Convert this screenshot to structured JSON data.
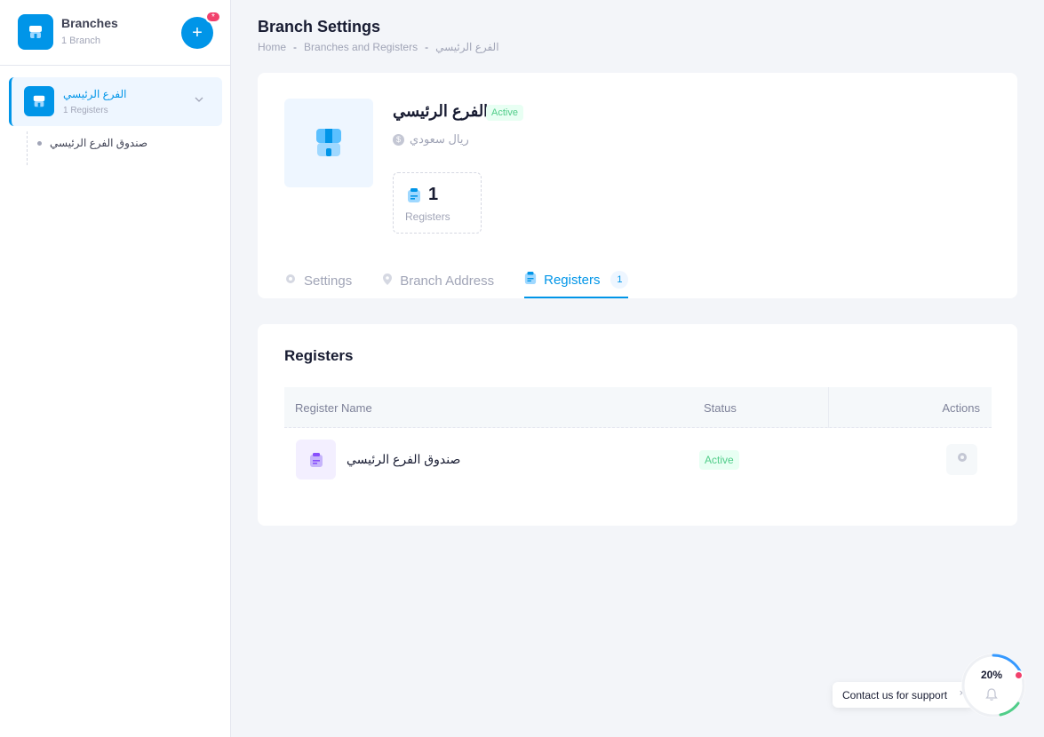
{
  "sidebar": {
    "title": "Branches",
    "subtitle": "1 Branch",
    "add_badge": "*",
    "branch": {
      "name": "الفرع الرئيسي",
      "sub": "1 Registers"
    },
    "registers": [
      {
        "name": "صندوق الفرع الرئيسي"
      }
    ]
  },
  "header": {
    "title": "Branch Settings",
    "breadcrumb": [
      "Home",
      "Branches and Registers",
      "الفرع الرئيسي"
    ],
    "separator": "-"
  },
  "branch": {
    "name": "الفرع الرئيسي",
    "status": "Active",
    "currency": "ريال سعودي",
    "currency_icon_label": "$",
    "stat_value": "1",
    "stat_label": "Registers"
  },
  "tabs": [
    {
      "label": "Settings",
      "icon": "gear-icon"
    },
    {
      "label": "Branch Address",
      "icon": "location-pin-icon"
    },
    {
      "label": "Registers",
      "icon": "register-icon",
      "count": "1",
      "active": true
    }
  ],
  "registers_table": {
    "title": "Registers",
    "columns": [
      "Register Name",
      "Status",
      "Actions"
    ],
    "rows": [
      {
        "name": "صندوق الفرع الرئيسي",
        "status": "Active"
      }
    ]
  },
  "support": {
    "label": "Contact us for support",
    "close": "×",
    "progress": 0.2,
    "progress_text": "20%"
  },
  "colors": {
    "primary": "#0095e8",
    "success": "#50cd89",
    "danger": "#f1416c",
    "purple": "#8950fc"
  }
}
